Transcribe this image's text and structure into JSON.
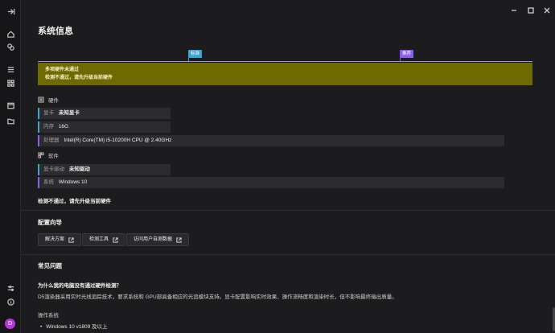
{
  "page": {
    "title": "系统信息",
    "markers": {
      "standard": "标准",
      "recommended": "推荐"
    },
    "warning": {
      "line1": "多项硬件未通过",
      "line2": "检测不通过，请先升级当前硬件"
    },
    "hardware": {
      "heading": "硬件",
      "rows": [
        {
          "label": "显卡",
          "value": "未知显卡"
        },
        {
          "label": "内存",
          "value": "16G"
        },
        {
          "label": "处理器",
          "value": "Intel(R) Core(TM) i5-10200H CPU @ 2.40GHz"
        }
      ]
    },
    "software": {
      "heading": "软件",
      "rows": [
        {
          "label": "显卡驱动",
          "value": "未知驱动"
        },
        {
          "label": "系统",
          "value": "Windows 10"
        }
      ]
    },
    "result": "检测不通过，请先升级当前硬件",
    "guide": {
      "heading": "配置向导",
      "buttons": [
        "解决方案",
        "检测工具",
        "访问用户自测数据"
      ]
    },
    "faq": {
      "heading": "常见问题",
      "question": "为什么我的电脑没有通过硬件检测？",
      "answer": "D5渲染器采用实时光线追踪技术，要求系统和 GPU部具备相应的光追模块支持。显卡配置影响实时效果、操作流畅度和渲染时长，但不影响最终输出质量。",
      "os_heading": "操作系统",
      "os_item": "Windows 10 v1809 及以上"
    }
  },
  "user": {
    "avatar_letter": "D"
  },
  "colors": {
    "accent_blue": "#3ea5d3",
    "accent_purple": "#8a5cf0",
    "warning_bg": "#6f6a00",
    "avatar": "#b23ad9"
  }
}
